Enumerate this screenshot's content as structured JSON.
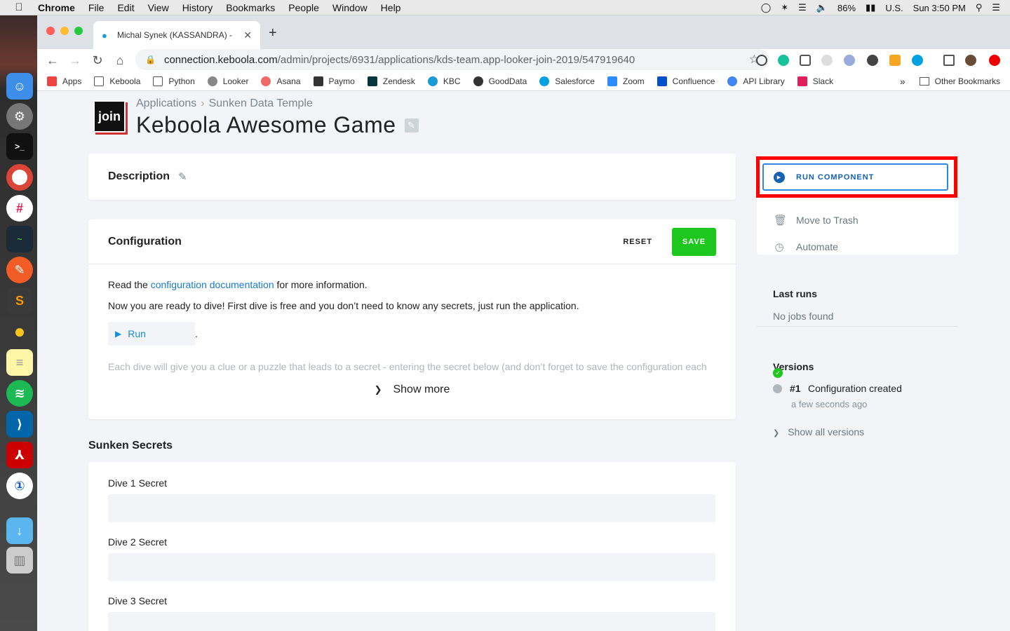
{
  "menubar": {
    "apple": "",
    "items": [
      "Chrome",
      "File",
      "Edit",
      "View",
      "History",
      "Bookmarks",
      "People",
      "Window",
      "Help"
    ],
    "battery": "86%",
    "input_source": "U.S.",
    "clock": "Sun 3:50 PM"
  },
  "browser": {
    "tab_title": "Michal Synek (KASSANDRA) - ",
    "tab_close": "✕",
    "new_tab": "+",
    "url_host": "connection.keboola.com",
    "url_path": "/admin/projects/6931/applications/kds-team.app-looker-join-2019/547919640",
    "bookmarks": [
      {
        "label": "Apps",
        "color": "#e44"
      },
      {
        "label": "Keboola",
        "color": "#666"
      },
      {
        "label": "Python",
        "color": "#666"
      },
      {
        "label": "Looker",
        "color": "#888"
      },
      {
        "label": "Asana",
        "color": "#f06a6a"
      },
      {
        "label": "Paymo",
        "color": "#333"
      },
      {
        "label": "Zendesk",
        "color": "#03363d"
      },
      {
        "label": "KBC",
        "color": "#1a9bd7"
      },
      {
        "label": "GoodData",
        "color": "#333"
      },
      {
        "label": "Salesforce",
        "color": "#00a1e0"
      },
      {
        "label": "Zoom",
        "color": "#2d8cff"
      },
      {
        "label": "Confluence",
        "color": "#0052cc"
      },
      {
        "label": "API Library",
        "color": "#4285f4"
      },
      {
        "label": "Slack",
        "color": "#e01e5a"
      }
    ],
    "bookmarks_more": "»",
    "other_bookmarks": "Other Bookmarks"
  },
  "page": {
    "logo_text": "join",
    "breadcrumb": [
      "Applications",
      "Sunken Data Temple"
    ],
    "breadcrumb_sep": "›",
    "title": "Keboola Awesome Game",
    "description_label": "Description",
    "configuration": {
      "title": "Configuration",
      "reset_label": "RESET",
      "save_label": "SAVE",
      "read_prefix": "Read the ",
      "doc_link": "configuration documentation",
      "read_suffix": " for more information.",
      "intro": "Now you are ready to dive! First dive is free and you don’t need to know any secrets, just run the application.",
      "run_label": "Run",
      "run_suffix": ".",
      "faded": "Each dive will give you a clue or a puzzle that leads to a secret - entering the secret below (and don’t forget to save the configuration each",
      "show_more": "Show more"
    },
    "secrets": {
      "title": "Sunken Secrets",
      "fields": [
        {
          "label": "Dive 1 Secret",
          "value": ""
        },
        {
          "label": "Dive 2 Secret",
          "value": ""
        },
        {
          "label": "Dive 3 Secret",
          "value": ""
        }
      ]
    }
  },
  "sidebar": {
    "run_component": "RUN COMPONENT",
    "move_to_trash": "Move to Trash",
    "automate": "Automate",
    "last_runs_title": "Last runs",
    "last_runs_empty": "No jobs found",
    "versions_title": "Versions",
    "version_number": "#1",
    "version_desc": "Configuration created",
    "version_time": "a few seconds ago",
    "show_all_versions": "Show all versions"
  },
  "colors": {
    "accent_blue": "#1462b3",
    "save_green": "#1ec71e",
    "highlight_red": "#ff0000"
  }
}
